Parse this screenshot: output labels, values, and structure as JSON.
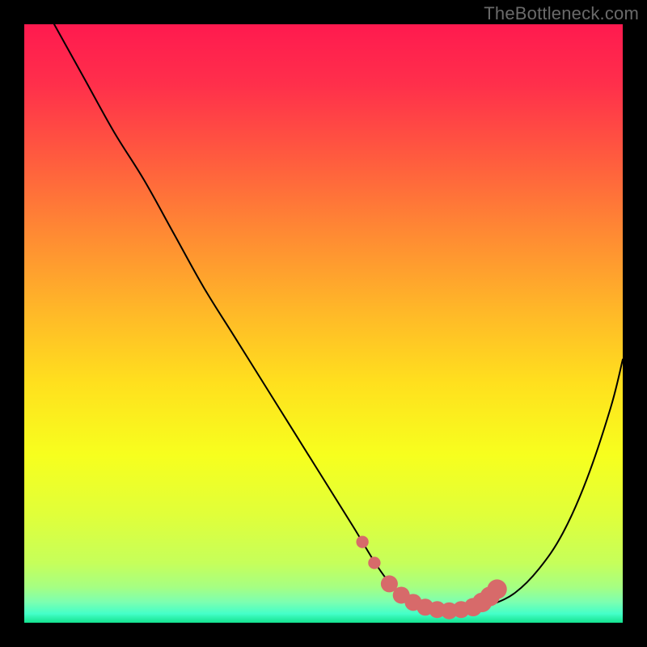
{
  "attribution": "TheBottleneck.com",
  "colors": {
    "frame": "#000000",
    "curve_stroke": "#000000",
    "highlight": "#d76a6a"
  },
  "gradient_stops": [
    {
      "offset": 0.0,
      "color": "#ff1a4f"
    },
    {
      "offset": 0.1,
      "color": "#ff2f4b"
    },
    {
      "offset": 0.22,
      "color": "#ff5a3f"
    },
    {
      "offset": 0.35,
      "color": "#ff8a33"
    },
    {
      "offset": 0.48,
      "color": "#ffb828"
    },
    {
      "offset": 0.6,
      "color": "#ffe01e"
    },
    {
      "offset": 0.72,
      "color": "#f7ff1e"
    },
    {
      "offset": 0.82,
      "color": "#e0ff3a"
    },
    {
      "offset": 0.9,
      "color": "#c6ff5a"
    },
    {
      "offset": 0.94,
      "color": "#a6ff82"
    },
    {
      "offset": 0.965,
      "color": "#7dffb0"
    },
    {
      "offset": 0.985,
      "color": "#44ffc8"
    },
    {
      "offset": 1.0,
      "color": "#14e28f"
    }
  ],
  "chart_data": {
    "type": "line",
    "title": "",
    "xlabel": "",
    "ylabel": "",
    "xlim": [
      0,
      100
    ],
    "ylim": [
      0,
      100
    ],
    "series": [
      {
        "name": "bottleneck_curve",
        "x": [
          5,
          10,
          15,
          20,
          25,
          30,
          35,
          40,
          45,
          50,
          55,
          58,
          60,
          62,
          64,
          66,
          68,
          70,
          72,
          75,
          78,
          82,
          86,
          90,
          94,
          98,
          100
        ],
        "y": [
          100,
          91,
          82,
          74,
          65,
          56,
          48,
          40,
          32,
          24,
          16,
          11,
          8,
          5.5,
          4,
          3,
          2.2,
          2,
          2,
          2.2,
          3,
          5,
          9,
          15,
          24,
          36,
          44
        ]
      }
    ],
    "highlight_caps": [
      {
        "x": 56.5,
        "y": 13.5,
        "r": 0.9
      },
      {
        "x": 58.5,
        "y": 10,
        "r": 0.9
      },
      {
        "x": 61,
        "y": 6.5,
        "r": 1.6
      },
      {
        "x": 63,
        "y": 4.6,
        "r": 1.6
      },
      {
        "x": 65,
        "y": 3.4,
        "r": 1.6
      },
      {
        "x": 67,
        "y": 2.6,
        "r": 1.6
      },
      {
        "x": 69,
        "y": 2.2,
        "r": 1.6
      },
      {
        "x": 71,
        "y": 2.0,
        "r": 1.6
      },
      {
        "x": 73,
        "y": 2.2,
        "r": 1.6
      },
      {
        "x": 75,
        "y": 2.6,
        "r": 1.8
      },
      {
        "x": 76.5,
        "y": 3.4,
        "r": 2.0
      },
      {
        "x": 77.8,
        "y": 4.4,
        "r": 2.0
      },
      {
        "x": 79,
        "y": 5.6,
        "r": 2.0
      }
    ]
  }
}
